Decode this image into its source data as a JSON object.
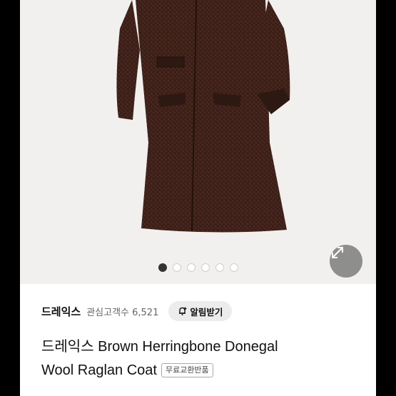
{
  "gallery": {
    "image_alt": "brown herringbone donegal wool coat",
    "total_images": 6,
    "active_index": 0
  },
  "store": {
    "name": "드레익스",
    "followers_label": "관심고객수 6,521"
  },
  "notify_button": {
    "icon": "bell-plus-icon",
    "label": "알림받기"
  },
  "product": {
    "title_line1": "드레익스 Brown Herringbone Donegal",
    "title_line2": "Wool Raglan Coat",
    "badge": "무료교환반품"
  },
  "colors": {
    "coat": "#3a2018",
    "background": "#f1f0ee",
    "accent": "#111111"
  }
}
